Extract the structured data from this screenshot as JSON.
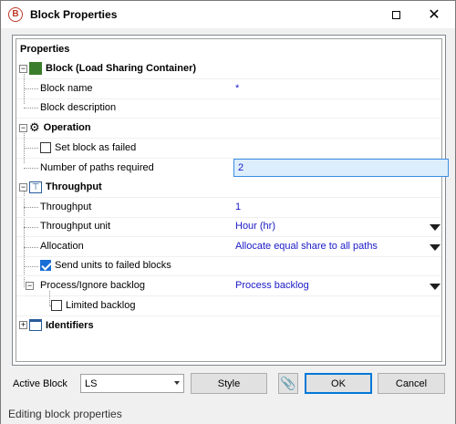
{
  "window": {
    "title": "Block Properties",
    "app_icon_letter": "B"
  },
  "grid": {
    "header": "Properties",
    "categories": {
      "block": {
        "label": "Block (Load Sharing Container)",
        "color": "#3a7d2c"
      },
      "operation": {
        "label": "Operation"
      },
      "throughput": {
        "label": "Throughput"
      },
      "identifiers": {
        "label": "Identifiers"
      }
    },
    "rows": {
      "block_name": {
        "label": "Block name",
        "value": "*"
      },
      "block_description": {
        "label": "Block description",
        "value": ""
      },
      "set_failed": {
        "label": "Set block as failed",
        "checked": false
      },
      "paths_required": {
        "label": "Number of paths required",
        "value": "2"
      },
      "throughput": {
        "label": "Throughput",
        "value": "1"
      },
      "throughput_unit": {
        "label": "Throughput unit",
        "value": "Hour (hr)"
      },
      "allocation": {
        "label": "Allocation",
        "value": "Allocate equal share to all paths"
      },
      "send_units": {
        "label": "Send units to failed blocks",
        "checked": true
      },
      "process_backlog": {
        "label": "Process/Ignore backlog",
        "value": "Process backlog"
      },
      "limited_backlog": {
        "label": "Limited backlog",
        "checked": false
      }
    }
  },
  "footer": {
    "active_block_label": "Active Block",
    "active_block_value": "LS",
    "style_button": "Style",
    "ok_button": "OK",
    "cancel_button": "Cancel"
  },
  "status": "Editing block properties",
  "colors": {
    "value_text": "#1919c8",
    "accent": "#0078d7",
    "selected_field": "#dceefc"
  }
}
